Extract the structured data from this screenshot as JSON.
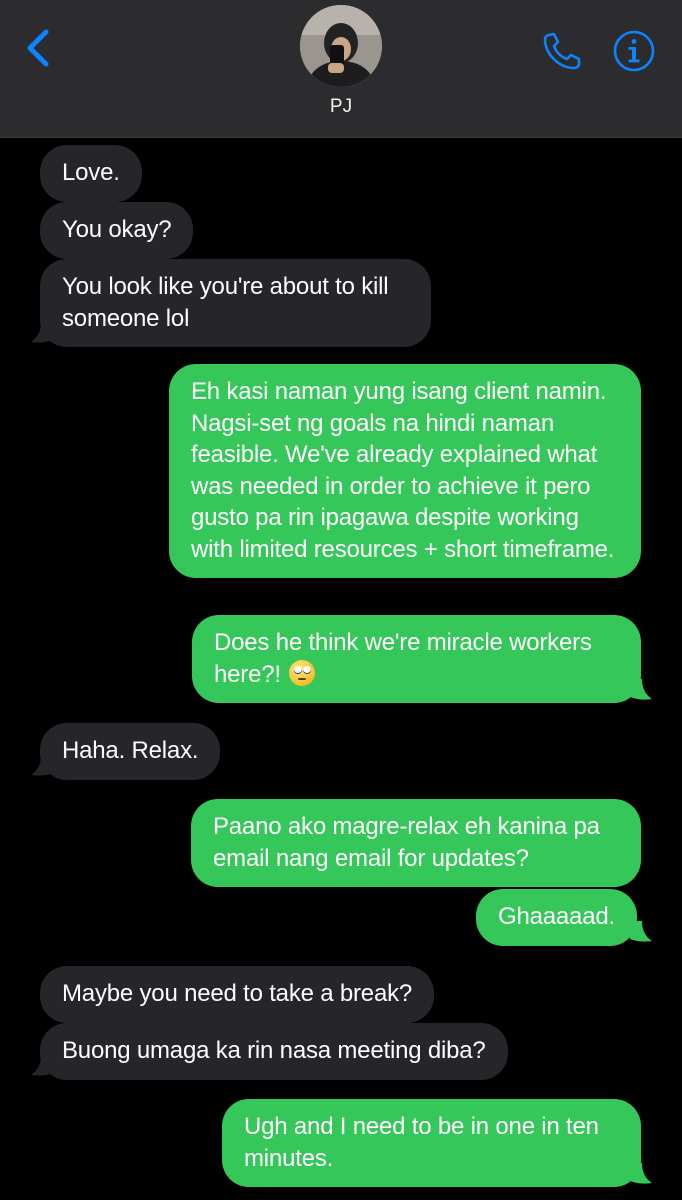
{
  "header": {
    "contact_name": "PJ",
    "back_icon": "chevron-left-icon",
    "call_icon": "phone-icon",
    "info_icon": "info-icon",
    "accent_color": "#0a84ff"
  },
  "colors": {
    "background": "#000000",
    "header_background": "#2c2c2e",
    "received_bubble": "#26252a",
    "sent_bubble": "#35c759"
  },
  "messages": [
    {
      "direction": "received",
      "text": "Love."
    },
    {
      "direction": "received",
      "text": "You okay?"
    },
    {
      "direction": "received",
      "text": "You look like you're about to kill someone lol"
    },
    {
      "direction": "sent",
      "text": "Eh kasi naman yung isang client namin. Nagsi-set ng goals na hindi naman feasible. We've already explained what was needed in order to achieve it pero gusto pa rin ipagawa despite working with limited resources + short timeframe."
    },
    {
      "direction": "sent",
      "text": "Does he think we're miracle workers here?!",
      "emoji": "face-with-rolling-eyes"
    },
    {
      "direction": "received",
      "text": "Haha. Relax."
    },
    {
      "direction": "sent",
      "text": "Paano ako magre-relax eh kanina pa email nang email for updates?"
    },
    {
      "direction": "sent",
      "text": "Ghaaaaad."
    },
    {
      "direction": "received",
      "text": "Maybe you need to take a break?"
    },
    {
      "direction": "received",
      "text": "Buong umaga ka rin nasa meeting diba?"
    },
    {
      "direction": "sent",
      "text": "Ugh and I need to be in one in ten minutes."
    }
  ]
}
